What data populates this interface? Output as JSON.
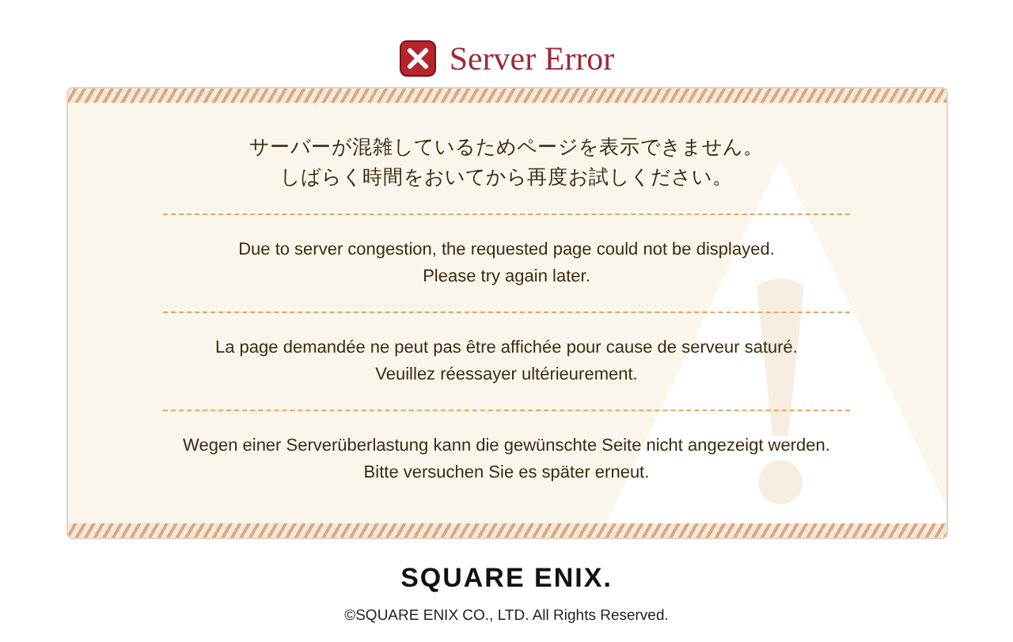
{
  "title": "Server Error",
  "messages": [
    {
      "lines": [
        "サーバーが混雑しているためページを表示できません。",
        "しばらく時間をおいてから再度お試しください。"
      ]
    },
    {
      "lines": [
        "Due to server congestion, the requested page could not be displayed.",
        "Please try again later."
      ]
    },
    {
      "lines": [
        "La page demandée ne peut pas être affichée pour cause de serveur saturé.",
        "Veuillez réessayer ultérieurement."
      ]
    },
    {
      "lines": [
        "Wegen einer Serverüberlastung kann die gewünschte Seite nicht angezeigt werden.",
        "Bitte versuchen Sie es später erneut."
      ]
    }
  ],
  "footer": {
    "logo": "SQUARE ENIX.",
    "copyright": "©SQUARE ENIX CO., LTD. All Rights Reserved."
  }
}
